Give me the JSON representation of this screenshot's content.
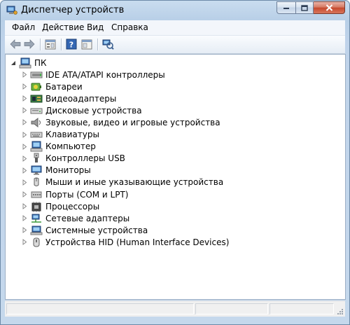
{
  "window": {
    "title": "Диспетчер устройств"
  },
  "menu": [
    {
      "label": "Файл"
    },
    {
      "label": "Действие"
    },
    {
      "label": "Вид"
    },
    {
      "label": "Справка"
    }
  ],
  "tree": {
    "root": {
      "label": "ПК",
      "icon": "computer-icon"
    },
    "items": [
      {
        "label": "IDE ATA/ATAPI контроллеры",
        "icon": "ide-controller-icon"
      },
      {
        "label": "Батареи",
        "icon": "battery-icon"
      },
      {
        "label": "Видеоадаптеры",
        "icon": "display-adapter-icon"
      },
      {
        "label": "Дисковые устройства",
        "icon": "disk-drive-icon"
      },
      {
        "label": "Звуковые, видео и игровые устройства",
        "icon": "speaker-icon"
      },
      {
        "label": "Клавиатуры",
        "icon": "keyboard-icon"
      },
      {
        "label": "Компьютер",
        "icon": "computer-icon"
      },
      {
        "label": "Контроллеры USB",
        "icon": "usb-icon"
      },
      {
        "label": "Мониторы",
        "icon": "monitor-icon"
      },
      {
        "label": "Мыши и иные указывающие устройства",
        "icon": "mouse-icon"
      },
      {
        "label": "Порты (COM и LPT)",
        "icon": "port-icon"
      },
      {
        "label": "Процессоры",
        "icon": "processor-icon"
      },
      {
        "label": "Сетевые адаптеры",
        "icon": "network-adapter-icon"
      },
      {
        "label": "Системные устройства",
        "icon": "system-devices-icon"
      },
      {
        "label": "Устройства HID (Human Interface Devices)",
        "icon": "hid-icon"
      }
    ]
  }
}
